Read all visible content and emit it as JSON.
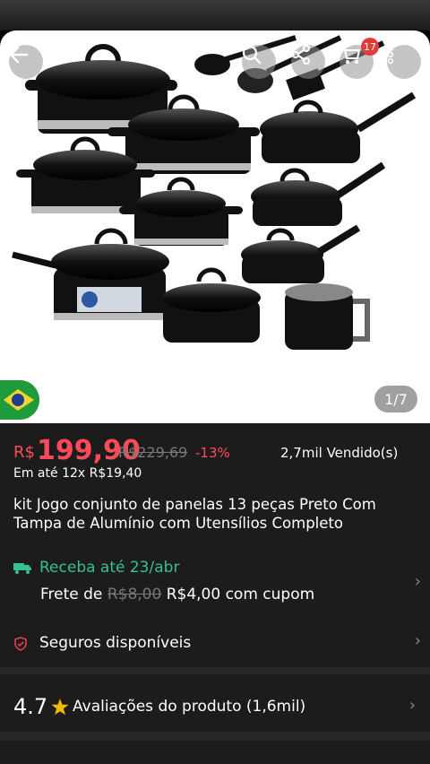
{
  "header": {
    "cart_count": "17",
    "image_counter": "1/7"
  },
  "product": {
    "currency": "R$",
    "price": "199,90",
    "old_price": "R$229,69",
    "discount": "-13%",
    "sold": "2,7mil Vendido(s)",
    "installments": "Em até 12x R$19,40",
    "title": "kit Jogo conjunto de panelas 13 peças Preto Com Tampa de Alumínio com Utensílios Completo"
  },
  "shipping": {
    "delivery": "Receba até 23/abr",
    "frete_prefix": "Frete de",
    "frete_old": "R$8,00",
    "frete_new": "R$4,00 com cupom"
  },
  "insurance": {
    "label": "Seguros disponíveis"
  },
  "reviews": {
    "rating": "4.7",
    "label": "Avaliações do produto (1,6mil)"
  },
  "colors": {
    "price_red": "#ff4a5c",
    "delivery_green": "#34c28f",
    "info_bg": "#1c1c1c"
  }
}
